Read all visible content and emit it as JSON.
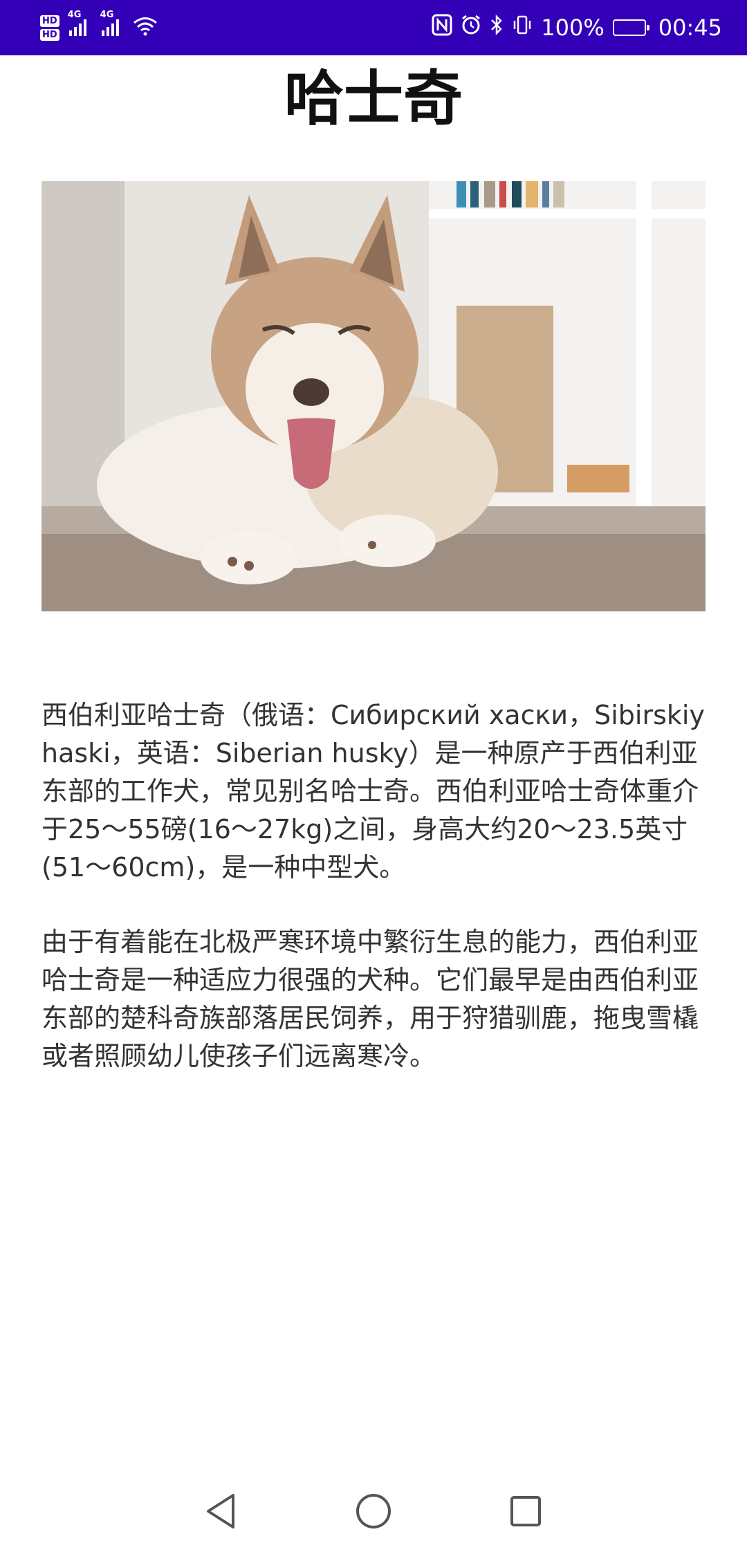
{
  "status_bar": {
    "hd1": "HD",
    "hd2": "HD",
    "net1": "4G",
    "net2": "4G",
    "battery": "100%",
    "time": "00:45",
    "icons": [
      "nfc-icon",
      "alarm-icon",
      "bluetooth-icon",
      "vibrate-icon",
      "battery-icon"
    ]
  },
  "page": {
    "title": "哈士奇",
    "image_name": "siberian-husky-photo",
    "paragraph1": "西伯利亚哈士奇（俄语：Сибирский хаски，Sibirskiy haski，英语：Siberian husky）是一种原产于西伯利亚东部的工作犬，常见别名哈士奇。西伯利亚哈士奇体重介于25～55磅(16～27kg)之间，身高大约20～23.5英寸(51～60cm)，是一种中型犬。",
    "paragraph2": "由于有着能在北极严寒环境中繁衍生息的能力，西伯利亚哈士奇是一种适应力很强的犬种。它们最早是由西伯利亚东部的楚科奇族部落居民饲养，用于狩猎驯鹿，拖曳雪橇或者照顾幼儿使孩子们远离寒冷。"
  },
  "nav_bar": {
    "icons": [
      "back-icon",
      "home-icon",
      "recents-icon"
    ]
  },
  "colors": {
    "status_bar_bg": "#3300b8",
    "text": "#333333",
    "title": "#111111"
  }
}
